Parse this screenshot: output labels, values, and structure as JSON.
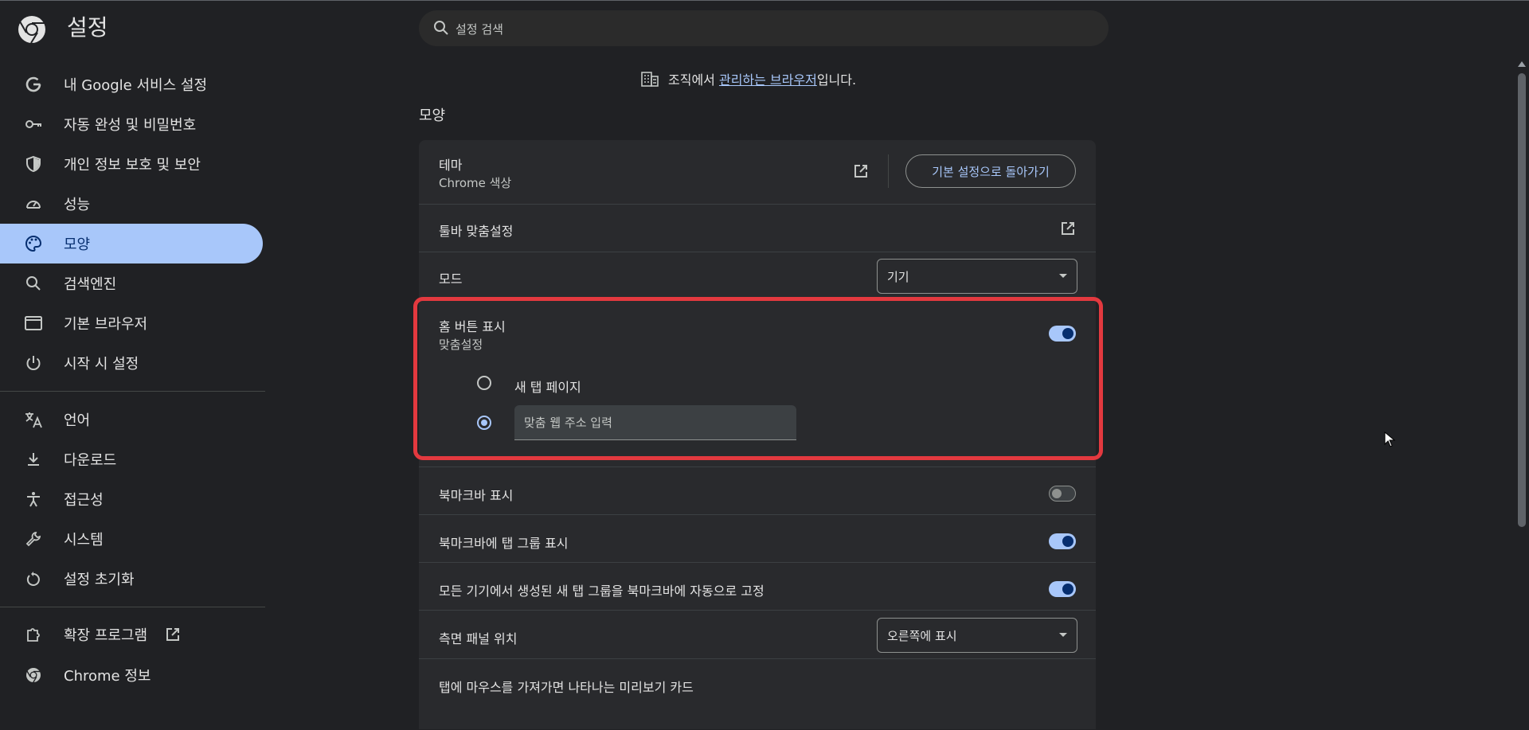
{
  "app": {
    "title": "설정"
  },
  "search": {
    "placeholder": "설정 검색"
  },
  "sidebar": {
    "items": [
      {
        "label": "내 Google 서비스 설정",
        "icon": "google-g-icon"
      },
      {
        "label": "자동 완성 및 비밀번호",
        "icon": "key-icon"
      },
      {
        "label": "개인 정보 보호 및 보안",
        "icon": "shield-icon"
      },
      {
        "label": "성능",
        "icon": "speedometer-icon"
      },
      {
        "label": "모양",
        "icon": "palette-icon",
        "active": true
      },
      {
        "label": "검색엔진",
        "icon": "search-icon"
      },
      {
        "label": "기본 브라우저",
        "icon": "browser-window-icon"
      },
      {
        "label": "시작 시 설정",
        "icon": "power-icon"
      },
      {
        "label": "언어",
        "icon": "translate-icon"
      },
      {
        "label": "다운로드",
        "icon": "download-icon"
      },
      {
        "label": "접근성",
        "icon": "accessibility-icon"
      },
      {
        "label": "시스템",
        "icon": "wrench-icon"
      },
      {
        "label": "설정 초기화",
        "icon": "reset-icon"
      },
      {
        "label": "확장 프로그램",
        "icon": "puzzle-icon"
      },
      {
        "label": "Chrome 정보",
        "icon": "chrome-icon"
      }
    ]
  },
  "managed": {
    "prefix": "조직에서 ",
    "link": "관리하는 브라우저",
    "suffix": "입니다."
  },
  "section": {
    "title": "모양"
  },
  "appearance": {
    "theme": {
      "label": "테마",
      "sub": "Chrome 색상",
      "reset_button": "기본 설정으로 돌아가기"
    },
    "toolbar": {
      "label": "툴바 맞춤설정"
    },
    "mode": {
      "label": "모드",
      "selected": "기기"
    },
    "home_button": {
      "label": "홈 버튼 표시",
      "sub": "맞춤설정",
      "enabled": true,
      "option_new_tab": "새 탭 페이지",
      "custom_url_placeholder": "맞춤 웹 주소 입력",
      "selected_option": "custom"
    },
    "bookmarks_bar": {
      "label": "북마크바 표시",
      "enabled": false
    },
    "tab_groups_in_bookmarks": {
      "label": "북마크바에 탭 그룹 표시",
      "enabled": true
    },
    "auto_pin_groups": {
      "label": "모든 기기에서 생성된 새 탭 그룹을 북마크바에 자동으로 고정",
      "enabled": true
    },
    "side_panel": {
      "label": "측면 패널 위치",
      "selected": "오른쪽에 표시"
    },
    "hover_cards": {
      "label": "탭에 마우스를 가져가면 나타나는 미리보기 카드"
    }
  },
  "colors": {
    "accent": "#a8c7fa",
    "highlight": "#e3393f",
    "background": "#202124",
    "card": "#292a2d"
  }
}
